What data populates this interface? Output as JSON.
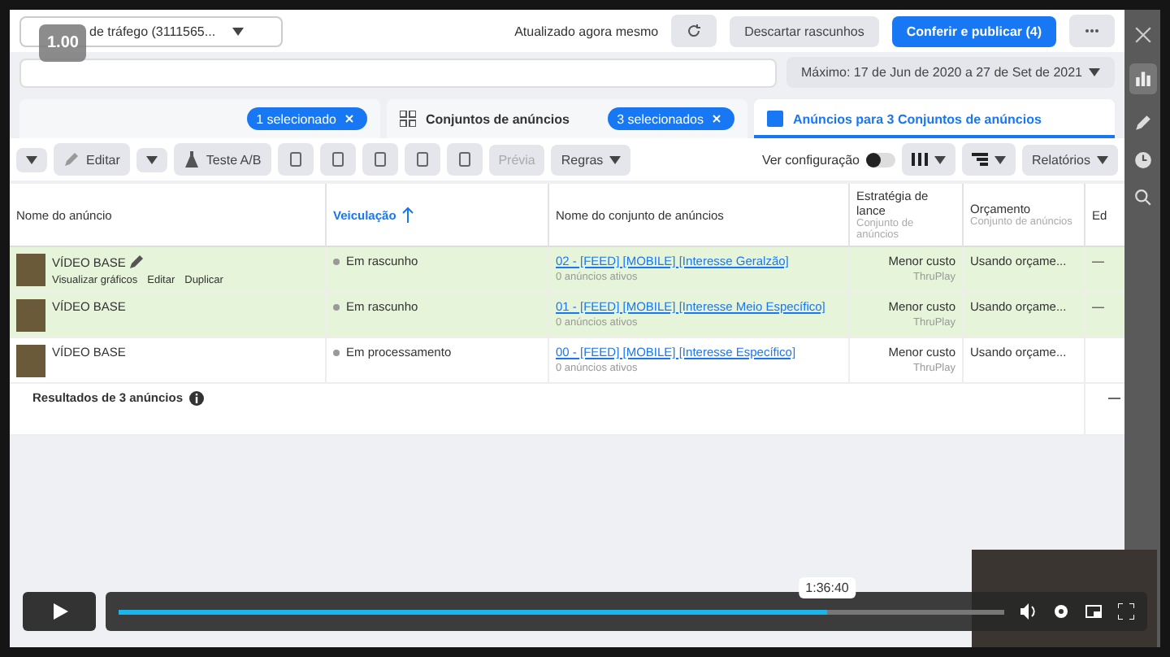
{
  "top_bar": {
    "campaign_select": "de tráfego (3111565...",
    "status": "Atualizado agora mesmo",
    "discard": "Descartar rascunhos",
    "publish": "Conferir e publicar (4)"
  },
  "date_range": "Máximo: 17 de Jun de 2020 a 27 de Set de 2021",
  "tabs": [
    {
      "chip": "1 selecionado",
      "selected": false
    },
    {
      "label": "Conjuntos de anúncios",
      "chip": "3 selecionados",
      "selected": false
    },
    {
      "label": "Anúncios para 3 Conjuntos de anúncios",
      "selected": true
    }
  ],
  "toolbar": {
    "edit": "Editar",
    "ab_test": "Teste A/B",
    "preview": "Prévia",
    "rules": "Regras",
    "view_setting": "Ver configuração",
    "view_setting_on": false,
    "reports": "Relatórios"
  },
  "table": {
    "columns": [
      {
        "title": "Nome do anúncio",
        "sorted": false
      },
      {
        "title": "Veiculação",
        "sorted": true
      },
      {
        "title": "Nome do conjunto de anúncios",
        "sorted": false
      },
      {
        "title": "Estratégia de lance",
        "sub": "Conjunto de anúncios",
        "sorted": false
      },
      {
        "title": "Orçamento",
        "sub": "Conjunto de anúncios",
        "sorted": false
      },
      {
        "title": "Ed",
        "sorted": false
      }
    ],
    "rows": [
      {
        "name": "VÍDEO BASE",
        "actions": [
          "Visualizar gráficos",
          "Editar",
          "Duplicar"
        ],
        "selected": true,
        "status": "Em rascunho",
        "ad_set": "02 - [FEED] [MOBILE] [Interesse Geralzão]",
        "ad_set_sub": "0 anúncios ativos",
        "bid": "Menor custo",
        "bid_sub": "ThruPlay",
        "budget": "Usando orçame...",
        "last": "—"
      },
      {
        "name": "VÍDEO BASE",
        "actions": [],
        "selected": true,
        "status": "Em rascunho",
        "ad_set": "01 - [FEED] [MOBILE] [Interesse Meio Específico]",
        "ad_set_sub": "0 anúncios ativos",
        "bid": "Menor custo",
        "bid_sub": "ThruPlay",
        "budget": "Usando orçame...",
        "last": "—"
      },
      {
        "name": "VÍDEO BASE",
        "actions": [],
        "selected": false,
        "status": "Em processamento",
        "ad_set": "00 - [FEED] [MOBILE] [Interesse Específico]",
        "ad_set_sub": "0 anúncios ativos",
        "bid": "Menor custo",
        "bid_sub": "ThruPlay",
        "budget": "Usando orçame...",
        "last": ""
      }
    ],
    "footer": "Resultados de 3 anúncios",
    "footer_last": "—"
  },
  "player": {
    "speed": "1.00",
    "time": "1:36:40",
    "level": 0.8
  }
}
